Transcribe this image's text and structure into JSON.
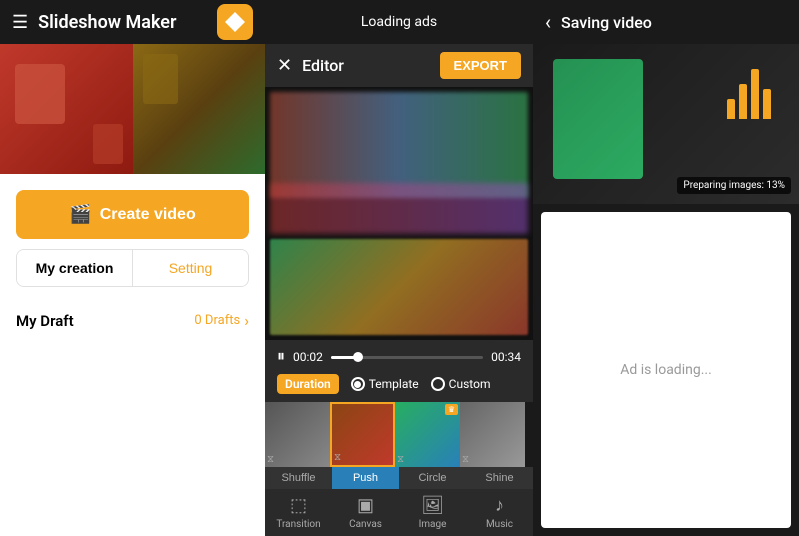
{
  "app": {
    "title": "Slideshow Maker"
  },
  "header": {
    "loading_ads": "Loading ads",
    "saving_video": "Saving video"
  },
  "editor": {
    "title": "Editor",
    "export_label": "EXPORT",
    "close_icon": "✕",
    "time_current": "00:02",
    "time_total": "00:34",
    "progress_percent": 18
  },
  "controls": {
    "duration_label": "Duration",
    "option_template": "Template",
    "option_custom": "Custom"
  },
  "transitions": {
    "shuffle": "Shuffle",
    "push": "Push",
    "circle": "Circle",
    "shine": "Shine"
  },
  "toolbar": {
    "transition_label": "Transition",
    "canvas_label": "Canvas",
    "image_label": "Image",
    "music_label": "Music"
  },
  "left": {
    "create_video_label": "Create video",
    "my_creation_label": "My creation",
    "setting_label": "Setting",
    "my_draft_label": "My Draft",
    "drafts_count": "0 Drafts"
  },
  "saving": {
    "preparing_text": "Preparing images: 13%"
  },
  "ad": {
    "loading_text": "Ad is loading..."
  }
}
